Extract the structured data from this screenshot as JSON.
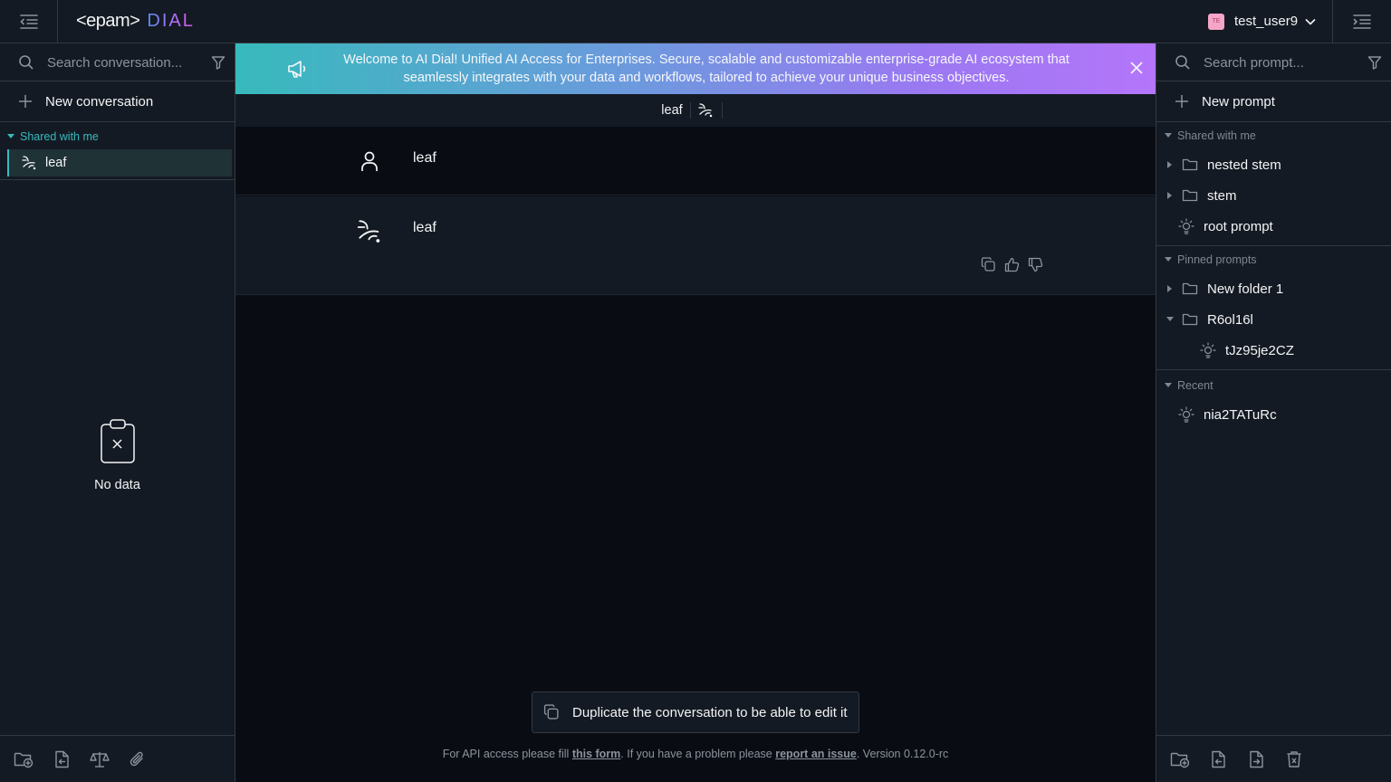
{
  "header": {
    "logo_epam": "<epam>",
    "logo_dial": "DIAL",
    "user_initials": "TE",
    "user_name": "test_user9",
    "avatar_color": "#f4a6c6"
  },
  "left_sidebar": {
    "search_placeholder": "Search conversation...",
    "new_conversation_label": "New conversation",
    "shared_section_label": "Shared with me",
    "conversations": [
      {
        "label": "leaf"
      }
    ],
    "empty_label": "No data"
  },
  "banner": {
    "text": "Welcome to AI Dial! Unified AI Access for Enterprises. Secure, scalable and customizable enterprise-grade AI ecosystem that seamlessly integrates with your data and workflows, tailored to achieve your unique business objectives."
  },
  "chat": {
    "header_title": "leaf",
    "messages": [
      {
        "role": "user",
        "text": "leaf"
      },
      {
        "role": "assistant",
        "text": "leaf"
      }
    ],
    "duplicate_label": "Duplicate the conversation to be able to edit it",
    "footer": {
      "prefix": "For API access please fill ",
      "form_link": "this form",
      "middle": ". If you have a problem please ",
      "issue_link": "report an issue",
      "suffix": ". Version 0.12.0-rc"
    }
  },
  "right_sidebar": {
    "search_placeholder": "Search prompt...",
    "new_prompt_label": "New prompt",
    "shared_section_label": "Shared with me",
    "shared_items": [
      "nested stem",
      "stem",
      "root prompt"
    ],
    "pinned_section_label": "Pinned prompts",
    "pinned_items": [
      "New folder 1",
      "R6ol16l",
      "tJz95je2CZ"
    ],
    "recent_section_label": "Recent",
    "recent_items": [
      "nia2TATuRc"
    ]
  },
  "colors": {
    "accent": "#37babc",
    "background": "#090d13",
    "panel": "#141a23",
    "border": "#333942"
  }
}
